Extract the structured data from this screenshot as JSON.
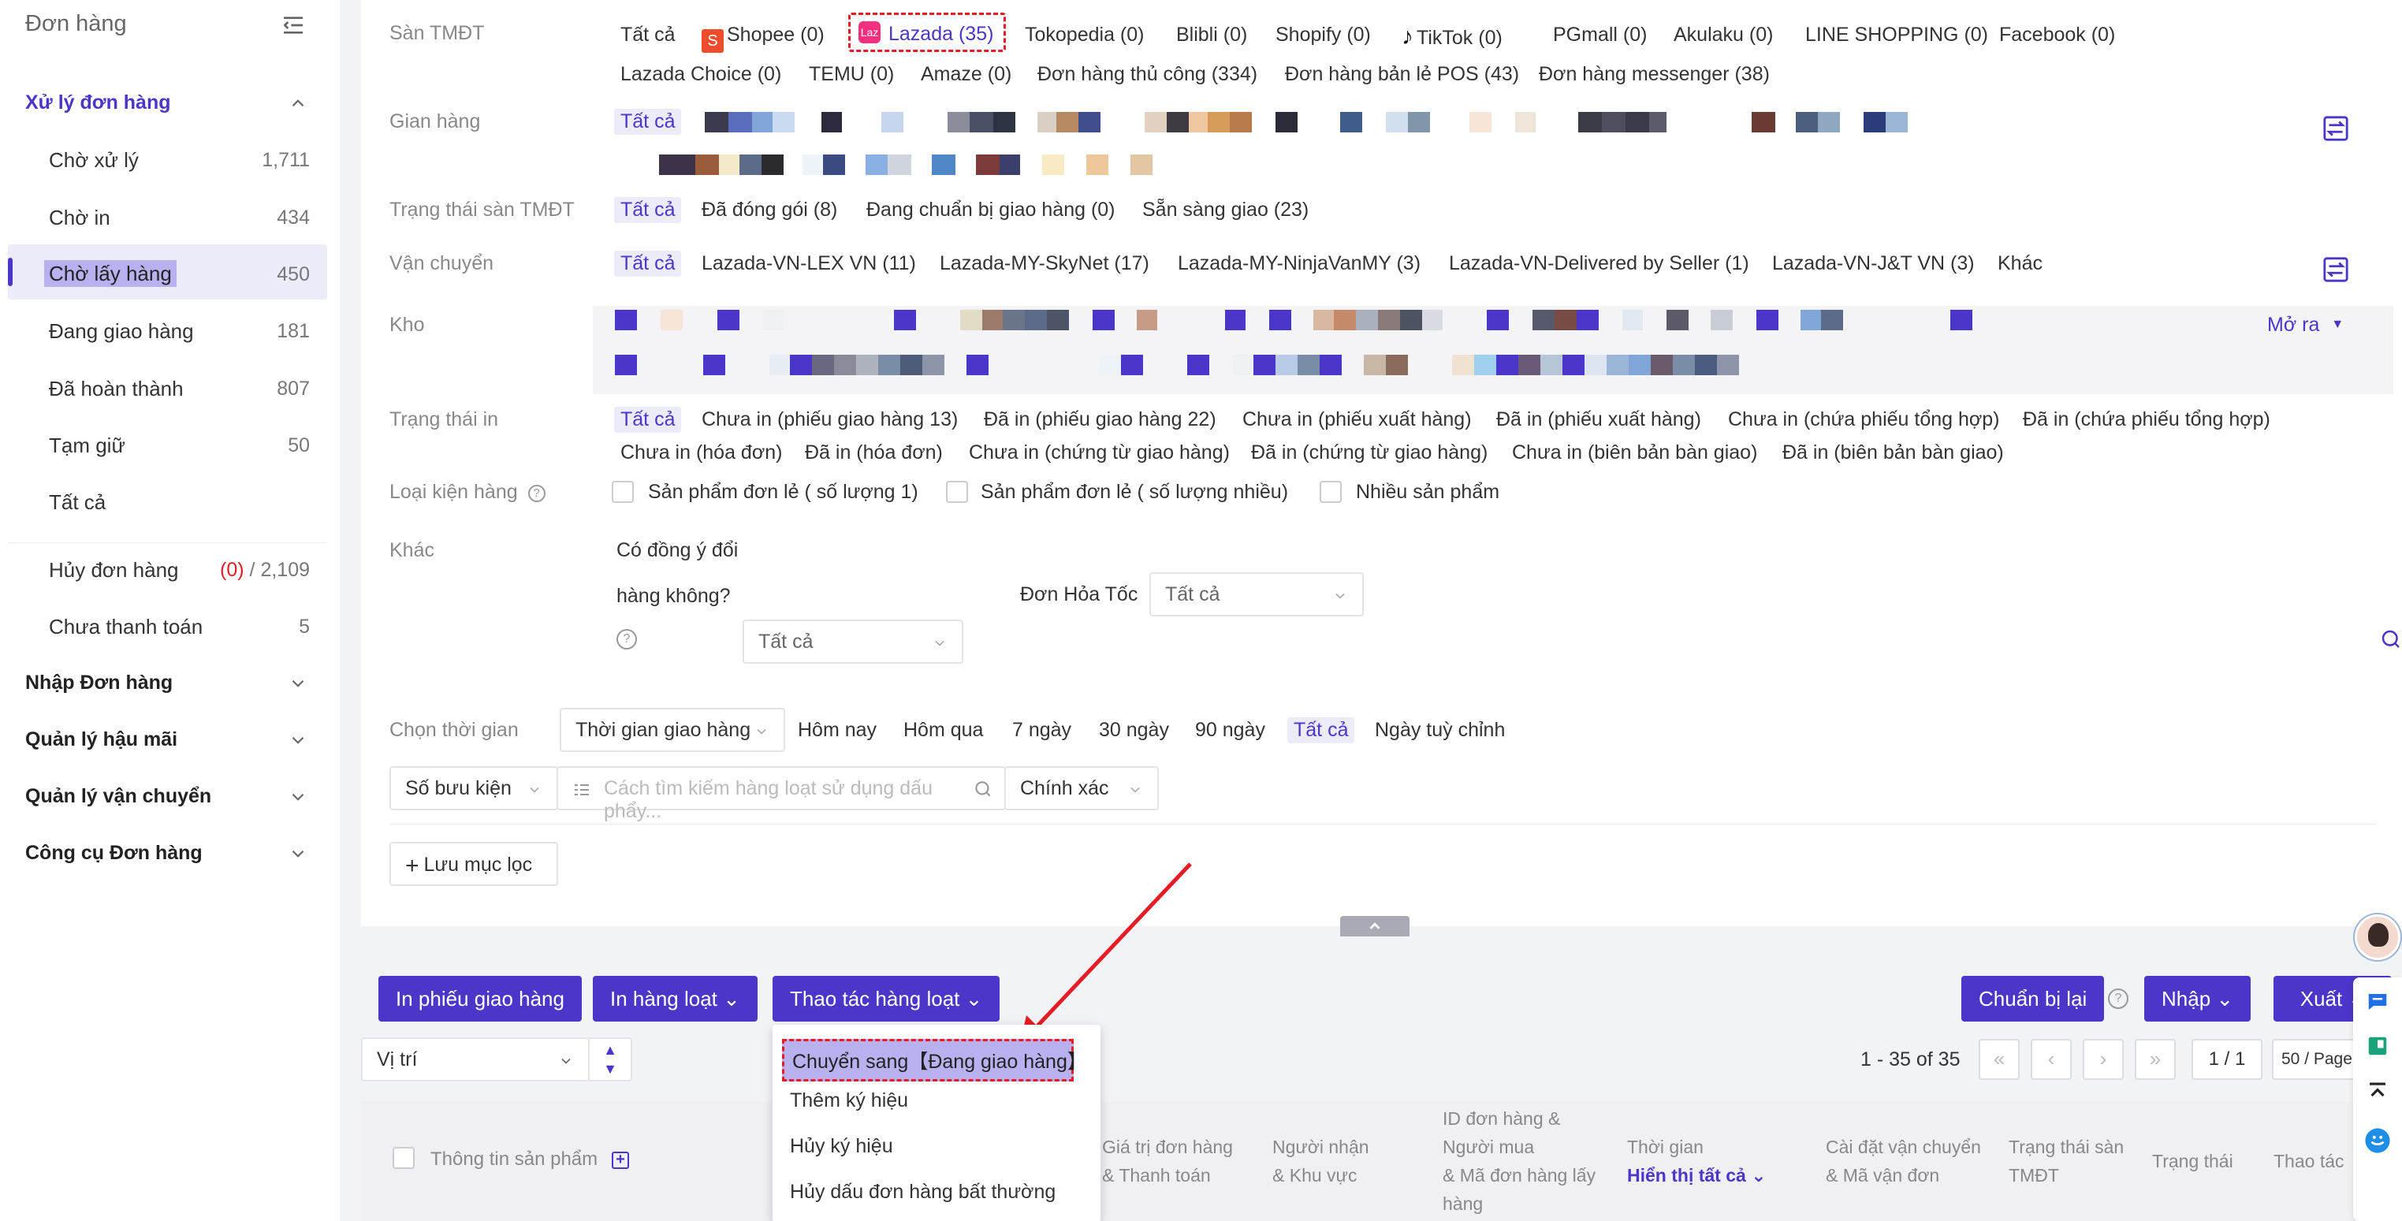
{
  "sidebar": {
    "title": "Đơn hàng",
    "groups": [
      {
        "label": "Xử lý đơn hàng",
        "expanded": true
      },
      {
        "label": "Nhập Đơn hàng"
      },
      {
        "label": "Quản lý hậu mãi"
      },
      {
        "label": "Quản lý vận chuyển"
      },
      {
        "label": "Công cụ Đơn hàng"
      }
    ],
    "items": [
      {
        "label": "Chờ xử lý",
        "count": "1,711"
      },
      {
        "label": "Chờ in",
        "count": "434"
      },
      {
        "label": "Chờ lấy hàng",
        "count": "450",
        "active": true
      },
      {
        "label": "Đang giao hàng",
        "count": "181"
      },
      {
        "label": "Đã hoàn thành",
        "count": "807"
      },
      {
        "label": "Tạm giữ",
        "count": "50"
      },
      {
        "label": "Tất cả",
        "count": ""
      },
      {
        "label": "Hủy đơn hàng",
        "count_red": "(0)",
        "count": "/ 2,109"
      },
      {
        "label": "Chưa thanh toán",
        "count": "5"
      }
    ]
  },
  "filters": {
    "san_label": "Sàn TMĐT",
    "san_options": [
      "Tất cả",
      "Shopee (0)",
      "Lazada (35)",
      "Tokopedia (0)",
      "Blibli (0)",
      "Shopify (0)",
      "TikTok (0)",
      "PGmall (0)",
      "Akulaku (0)",
      "LINE SHOPPING (0)",
      "Facebook (0)"
    ],
    "san_options_row2": [
      "Lazada Choice (0)",
      "TEMU (0)",
      "Amaze (0)",
      "Đơn hàng thủ công (334)",
      "Đơn hàng bản lẻ POS (43)",
      "Đơn hàng messenger (38)"
    ],
    "gian_hang_label": "Gian hàng",
    "gian_hang_all": "Tất cả",
    "trang_thai_san_label": "Trạng thái sàn TMĐT",
    "trang_thai_san_options": [
      "Tất cả",
      "Đã đóng gói (8)",
      "Đang chuẩn bị giao hàng (0)",
      "Sẵn sàng giao (23)"
    ],
    "van_chuyen_label": "Vận chuyển",
    "van_chuyen_options": [
      "Tất cả",
      "Lazada-VN-LEX VN (11)",
      "Lazada-MY-SkyNet (17)",
      "Lazada-MY-NinjaVanMY (3)",
      "Lazada-VN-Delivered by Seller (1)",
      "Lazada-VN-J&T VN (3)",
      "Khác"
    ],
    "kho_label": "Kho",
    "kho_expand": "Mở ra",
    "trang_thai_in_label": "Trạng thái in",
    "trang_thai_in_options": [
      "Tất cả",
      "Chưa in (phiếu giao hàng 13)",
      "Đã in (phiếu giao hàng 22)",
      "Chưa in (phiếu xuất hàng)",
      "Đã in (phiếu xuất hàng)",
      "Chưa in (chứa phiếu tổng hợp)",
      "Đã in (chứa phiếu tổng hợp)"
    ],
    "trang_thai_in_row2": [
      "Chưa in (hóa đơn)",
      "Đã in (hóa đơn)",
      "Chưa in (chứng từ giao hàng)",
      "Đã in (chứng từ giao hàng)",
      "Chưa in (biên bản bàn giao)",
      "Đã in (biên bản bàn giao)"
    ],
    "loai_kien_label": "Loại kiện hàng",
    "loai_kien_options": [
      "Sản phẩm đơn lẻ ( số lượng 1)",
      "Sản phẩm đơn lẻ ( số lượng nhiều)",
      "Nhiều sản phẩm"
    ],
    "khac_label": "Khác",
    "dong_y_doi_line1": "Có đồng ý đổi",
    "dong_y_doi_line2": "hàng không?",
    "dong_y_doi_value": "Tất cả",
    "hoa_toc_label": "Đơn Hỏa Tốc",
    "hoa_toc_value": "Tất cả",
    "thoi_gian_label": "Chọn thời gian",
    "thoi_gian_select": "Thời gian giao hàng",
    "thoi_gian_options": [
      "Hôm nay",
      "Hôm qua",
      "7 ngày",
      "30 ngày",
      "90 ngày",
      "Tất cả",
      "Ngày tuỳ chỉnh"
    ],
    "search_field_select": "Số bưu kiện",
    "search_placeholder": "Cách tìm kiếm hàng loạt sử dụng dấu phẩy...",
    "search_mode": "Chính xác",
    "save_filter": "Lưu mục lọc"
  },
  "toolbar": {
    "print_shipping": "In phiếu giao hàng",
    "bulk_print": "In hàng loạt",
    "bulk_action": "Thao tác hàng loạt",
    "reprepare": "Chuẩn bị lại",
    "import": "Nhập",
    "export": "Xuất",
    "position_select": "Vị trí",
    "pager_text": "1 - 35 of 35",
    "page_value": "1 / 1",
    "page_size": "50 / Page"
  },
  "dropdown": {
    "items": [
      "Chuyển sang【Đang giao hàng】",
      "Thêm ký hiệu",
      "Hủy ký hiệu",
      "Hủy dấu đơn hàng bất thường"
    ]
  },
  "table": {
    "headers": {
      "product": "Thông tin sản phẩm",
      "value_l1": "Giá trị đơn hàng",
      "value_l2": "& Thanh toán",
      "recipient_l1": "Người nhận",
      "recipient_l2": "& Khu vực",
      "id_l1": "ID đơn hàng &",
      "id_l2": "Người mua",
      "id_l3": "& Mã đơn hàng lấy",
      "id_l4": "hàng",
      "time_l1": "Thời gian",
      "time_l2": "Hiển thị tất cả",
      "ship_l1": "Cài đặt vận chuyển",
      "ship_l2": "& Mã vận đơn",
      "status_l1": "Trạng thái sàn",
      "status_l2": "TMĐT",
      "state": "Trạng thái",
      "action": "Thao tác"
    }
  },
  "colors": {
    "accent": "#4a36c9",
    "accent_light": "#ecebfa",
    "highlight": "#b9b0f0",
    "danger": "#e51c23",
    "shopee": "#ee4d2d",
    "lazada": "#f5317f"
  }
}
